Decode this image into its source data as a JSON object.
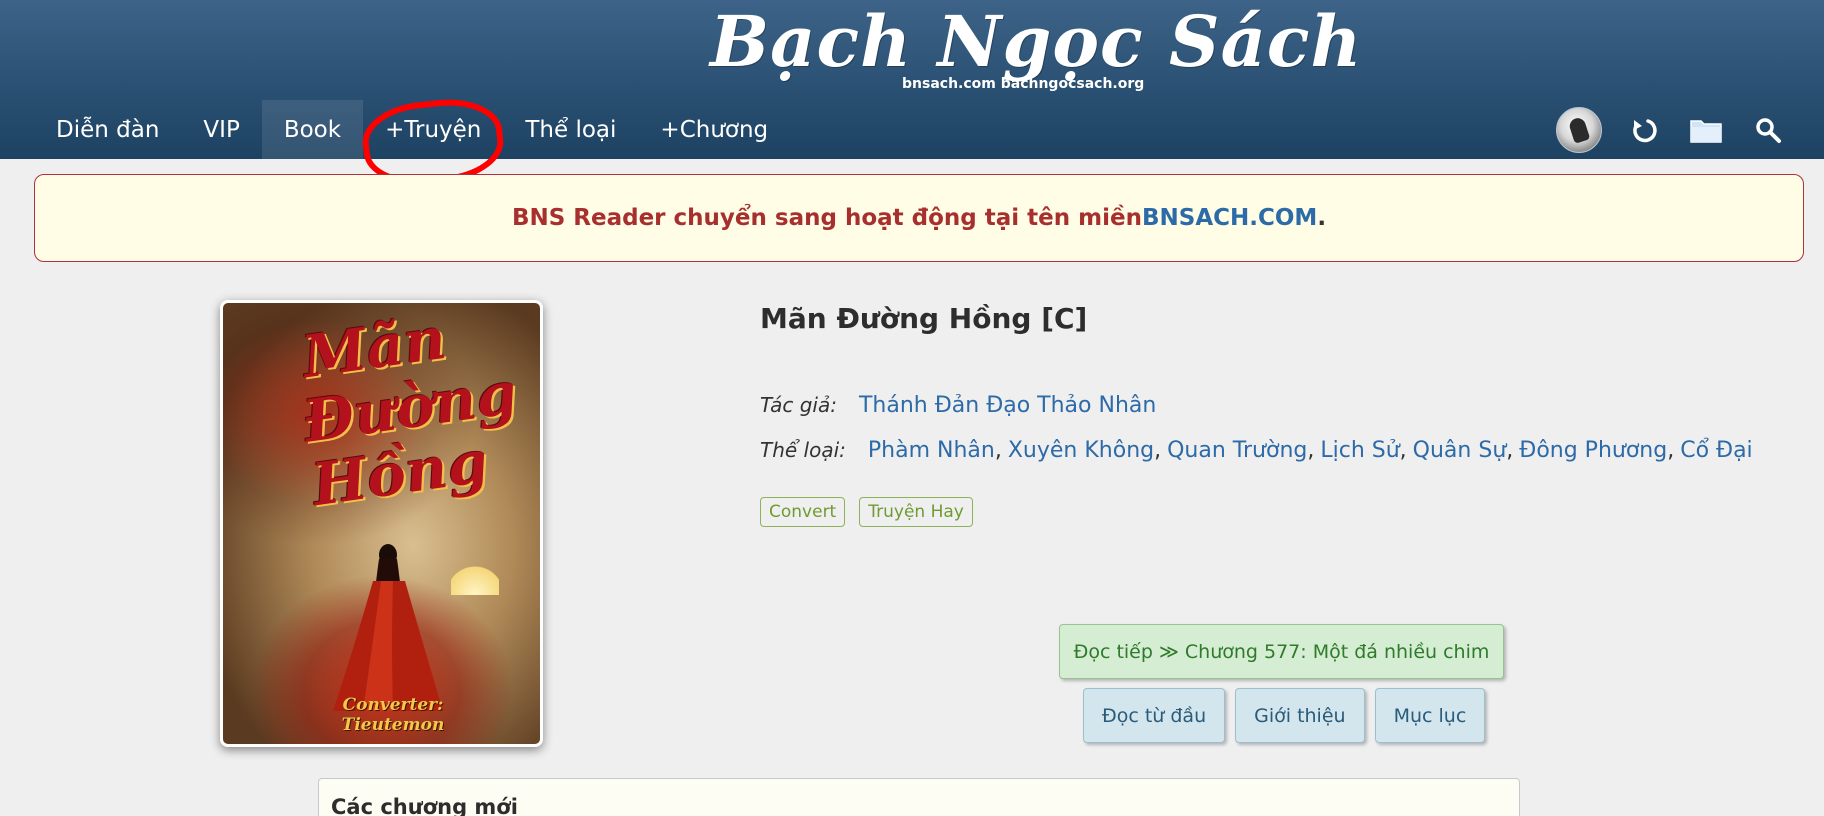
{
  "site": {
    "logo_text": "Bạch Ngọc Sách",
    "logo_domains": "bnsach.com bachngocsach.org"
  },
  "nav": {
    "items": [
      {
        "label": "Diễn đàn"
      },
      {
        "label": "VIP"
      },
      {
        "label": "Book"
      },
      {
        "label": "+Truyện"
      },
      {
        "label": "Thể loại"
      },
      {
        "label": "+Chương"
      }
    ],
    "active": "Book",
    "icons": [
      "avatar",
      "refresh-icon",
      "folder-icon",
      "search-icon"
    ]
  },
  "notice": {
    "text": "BNS Reader chuyển sang hoạt động tại tên miền ",
    "link": "BNSACH.COM",
    "suffix": "."
  },
  "book": {
    "title": "Mãn Đường Hồng [C]",
    "cover_title": "Mãn Đường Hồng",
    "cover_credit": "Converter: Tieutemon",
    "author_label": "Tác giả:",
    "author": "Thánh Đản Đạo Thảo Nhân",
    "genre_label": "Thể loại:",
    "genres": [
      "Phàm Nhân",
      "Xuyên Không",
      "Quan Trường",
      "Lịch Sử",
      "Quân Sự",
      "Đông Phương",
      "Cổ Đại"
    ],
    "tags": [
      "Convert",
      "Truyện Hay"
    ]
  },
  "actions": {
    "continue": "Đọc tiếp ≫ Chương 577: Một đá nhiều chim",
    "read_from_start": "Đọc từ đầu",
    "intro": "Giới thiệu",
    "toc": "Mục lục"
  },
  "new_chapters": {
    "title": "Các chương mới"
  },
  "colors": {
    "header": "#2a5073",
    "link": "#2d6aa8",
    "notice_text": "#a7302e",
    "highlight_circle": "#ff0000"
  }
}
